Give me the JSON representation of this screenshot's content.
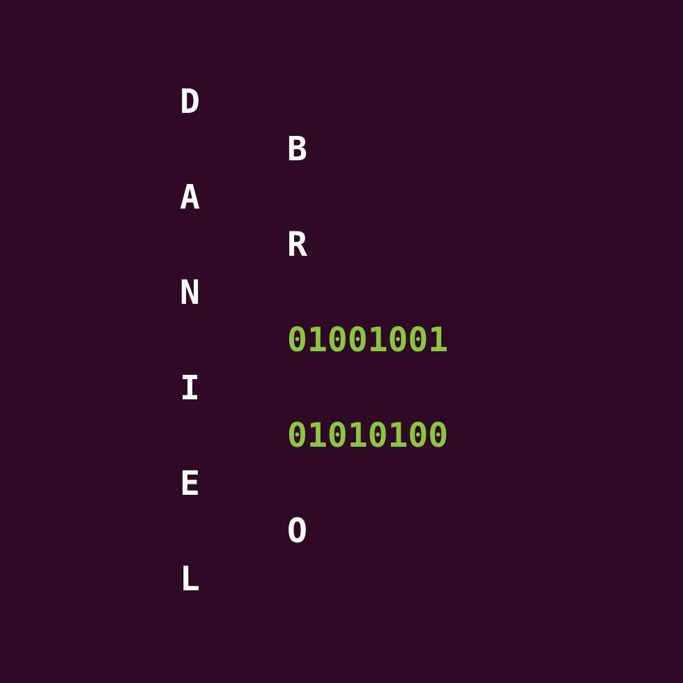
{
  "colors": {
    "background": "#2e0a25",
    "letter": "#ffffff",
    "binary": "#8cc63f"
  },
  "left_column": [
    "D",
    "A",
    "N",
    "I",
    "E",
    "L"
  ],
  "right_column": [
    "B",
    "R",
    "01001001",
    "01010100",
    "O"
  ]
}
